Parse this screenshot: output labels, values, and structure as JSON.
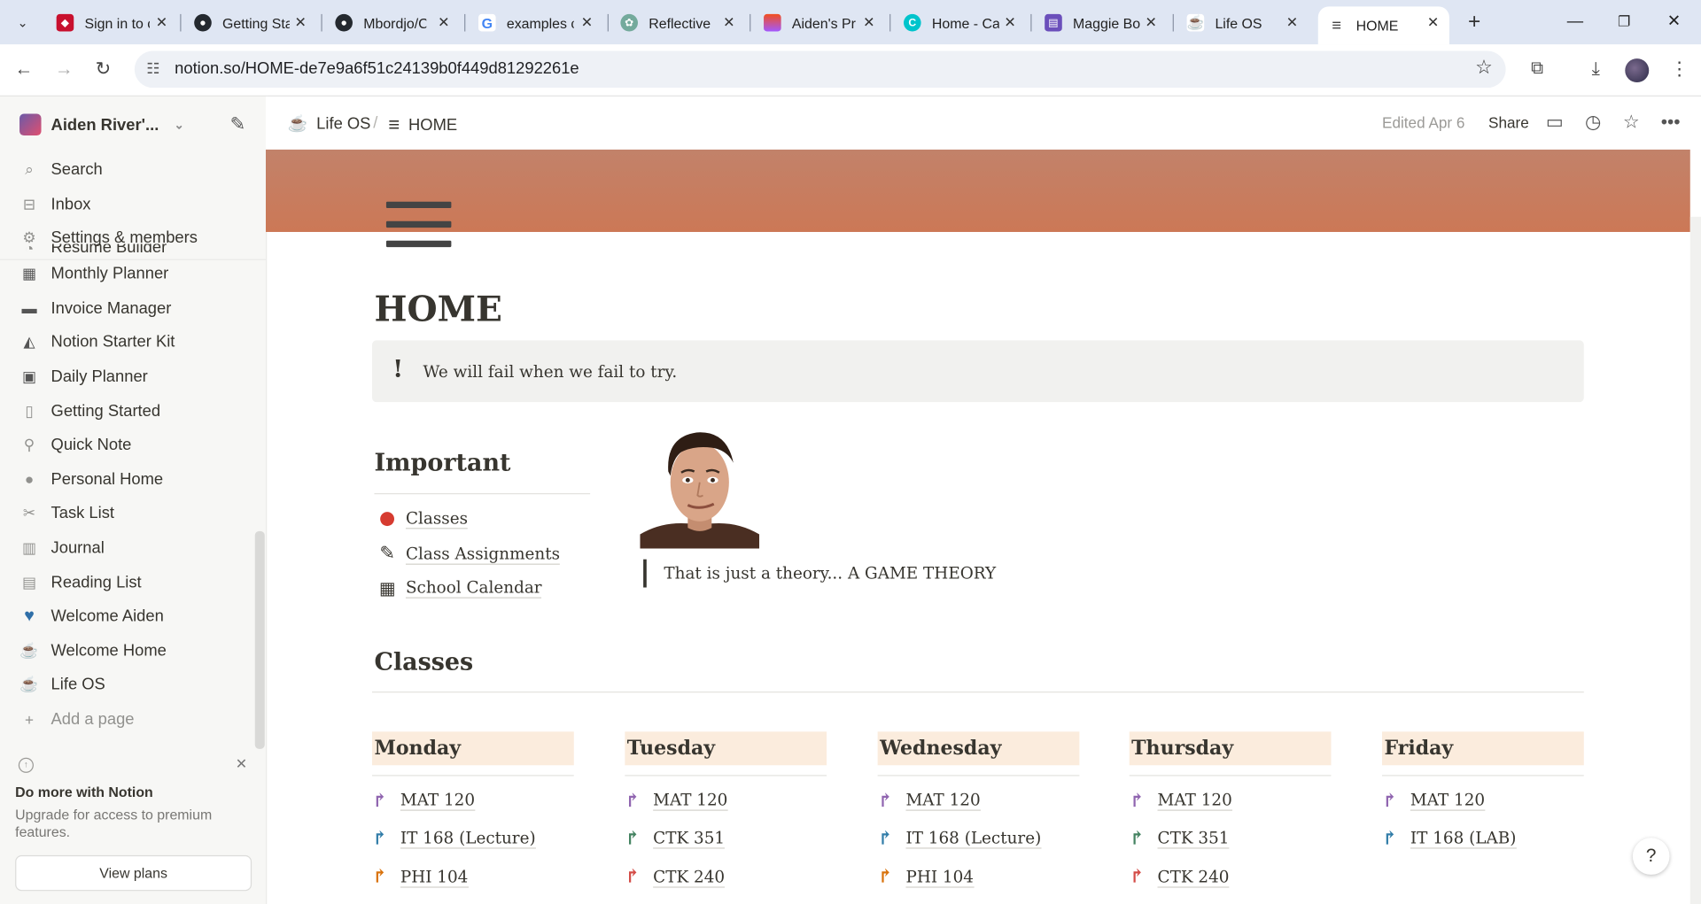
{
  "browser": {
    "tabs": [
      {
        "title": "Sign in to c",
        "icon": "cardinal-icon",
        "color": "#c8102e"
      },
      {
        "title": "Getting Sta",
        "icon": "github-icon",
        "color": "#24292f"
      },
      {
        "title": "Mbordjo/C",
        "icon": "github-icon",
        "color": "#24292f"
      },
      {
        "title": "examples c",
        "icon": "google-icon",
        "color": "#4285f4"
      },
      {
        "title": "Reflective",
        "icon": "chatgpt-icon",
        "color": "#74aa9c"
      },
      {
        "title": "Aiden's Pr",
        "icon": "figma-icon",
        "color": "#f24e1e"
      },
      {
        "title": "Home - Ca",
        "icon": "canva-icon",
        "color": "#00c4cc"
      },
      {
        "title": "Maggie Bo",
        "icon": "printer-icon",
        "color": "#6b4fbb"
      },
      {
        "title": "Life OS",
        "icon": "coffee-icon",
        "color": "#8a6d4e"
      },
      {
        "title": "HOME",
        "icon": "menu-icon",
        "color": "#444444",
        "active": true
      }
    ],
    "url": "notion.so/HOME-de7e9a6f51c24139b0f449d81292261e"
  },
  "sidebar": {
    "workspace": "Aiden River'...",
    "top": [
      {
        "label": "Search",
        "icon": "search-icon"
      },
      {
        "label": "Inbox",
        "icon": "inbox-icon"
      },
      {
        "label": "Settings & members",
        "icon": "gear-icon"
      }
    ],
    "pages": [
      {
        "label": "Resume Builder",
        "icon": "document-icon"
      },
      {
        "label": "Monthly Planner",
        "icon": "calendar-icon"
      },
      {
        "label": "Invoice Manager",
        "icon": "folder-icon"
      },
      {
        "label": "Notion Starter Kit",
        "icon": "shapes-icon"
      },
      {
        "label": "Daily Planner",
        "icon": "calendar-check-icon"
      },
      {
        "label": "Getting Started",
        "icon": "page-icon"
      },
      {
        "label": "Quick Note",
        "icon": "pin-icon"
      },
      {
        "label": "Personal Home",
        "icon": "person-icon"
      },
      {
        "label": "Task List",
        "icon": "scissors-icon"
      },
      {
        "label": "Journal",
        "icon": "book-icon"
      },
      {
        "label": "Reading List",
        "icon": "books-icon"
      },
      {
        "label": "Welcome Aiden",
        "icon": "heart-icon"
      },
      {
        "label": "Welcome Home",
        "icon": "coffee-icon"
      },
      {
        "label": "Life OS",
        "icon": "coffee-icon"
      },
      {
        "label": "Add a page",
        "icon": "plus-icon"
      }
    ],
    "upgrade": {
      "title": "Do more with Notion",
      "desc": "Upgrade for access to premium features.",
      "button": "View plans"
    }
  },
  "topbar": {
    "crumb1": "Life OS",
    "crumb2": "HOME",
    "edited": "Edited Apr 6",
    "share": "Share"
  },
  "page": {
    "title": "HOME",
    "callout": "We will fail when we fail to try.",
    "important": {
      "heading": "Important",
      "links": [
        {
          "label": "Classes",
          "icon": "apple-icon"
        },
        {
          "label": "Class Assignments",
          "icon": "edit-icon"
        },
        {
          "label": "School Calendar",
          "icon": "calendar-icon"
        }
      ]
    },
    "quote": "That is just a theory... A GAME THEORY",
    "classes_heading": "Classes",
    "days": [
      {
        "name": "Monday",
        "items": [
          {
            "label": "MAT 120",
            "color": "#9065b0"
          },
          {
            "label": "IT 168 (Lecture)",
            "color": "#337ea9"
          },
          {
            "label": "PHI 104",
            "color": "#d9730d"
          }
        ]
      },
      {
        "name": "Tuesday",
        "items": [
          {
            "label": "MAT 120",
            "color": "#9065b0"
          },
          {
            "label": "CTK 351",
            "color": "#448361"
          },
          {
            "label": "CTK 240",
            "color": "#d44c47"
          }
        ]
      },
      {
        "name": "Wednesday",
        "items": [
          {
            "label": "MAT 120",
            "color": "#9065b0"
          },
          {
            "label": "IT 168 (Lecture)",
            "color": "#337ea9"
          },
          {
            "label": "PHI 104",
            "color": "#d9730d"
          }
        ]
      },
      {
        "name": "Thursday",
        "items": [
          {
            "label": "MAT 120",
            "color": "#9065b0"
          },
          {
            "label": "CTK 351",
            "color": "#448361"
          },
          {
            "label": "CTK 240",
            "color": "#d44c47"
          }
        ]
      },
      {
        "name": "Friday",
        "items": [
          {
            "label": "MAT 120",
            "color": "#9065b0"
          },
          {
            "label": "IT 168 (LAB)",
            "color": "#337ea9"
          }
        ]
      }
    ]
  },
  "help": "?"
}
